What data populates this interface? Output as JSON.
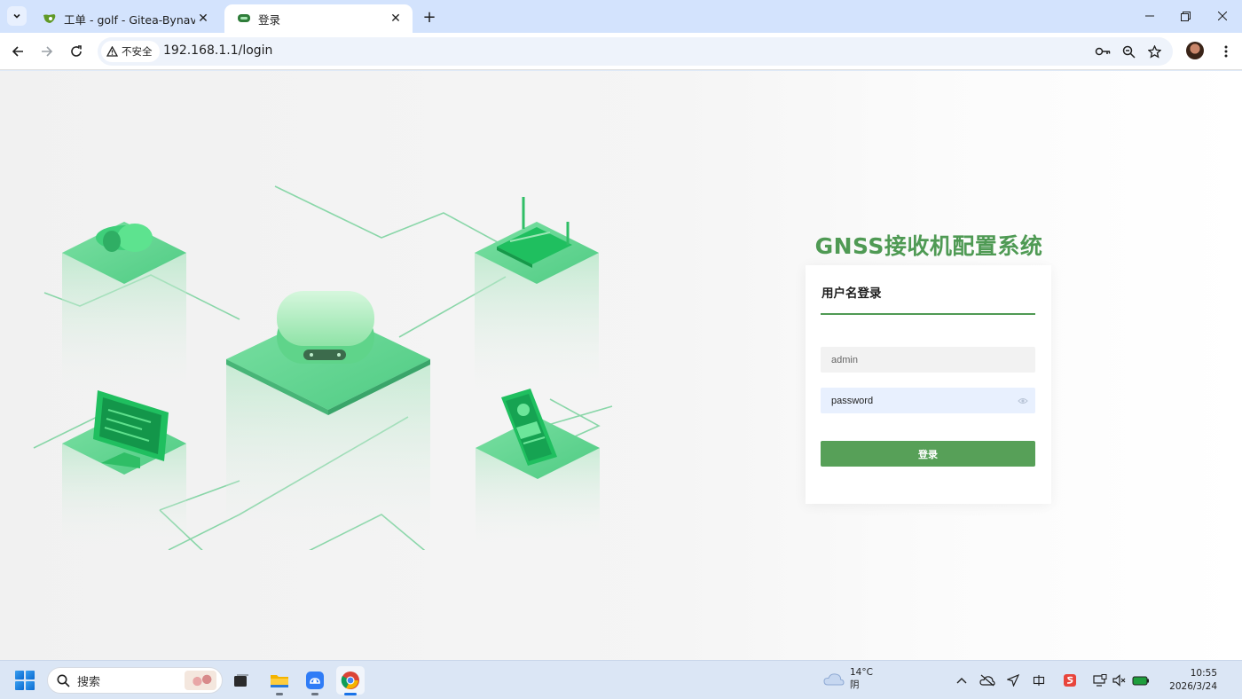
{
  "browser": {
    "tabs": [
      {
        "title": "工单 - golf - Gitea-Bynav",
        "active": false
      },
      {
        "title": "登录",
        "active": true
      }
    ],
    "security_label": "不安全",
    "url": "192.168.1.1/login"
  },
  "page": {
    "system_title": "GNSS接收机配置系统",
    "login_card": {
      "heading": "用户名登录",
      "username_value": "admin",
      "password_value": "password",
      "submit_label": "登录"
    }
  },
  "taskbar": {
    "search_placeholder": "搜索",
    "weather": {
      "temp": "14°C",
      "condition": "阴"
    },
    "clock": {
      "time": "10:55",
      "date": "2026/3/24"
    }
  },
  "colors": {
    "accent_green": "#57a058",
    "title_green": "#4f9a54"
  }
}
